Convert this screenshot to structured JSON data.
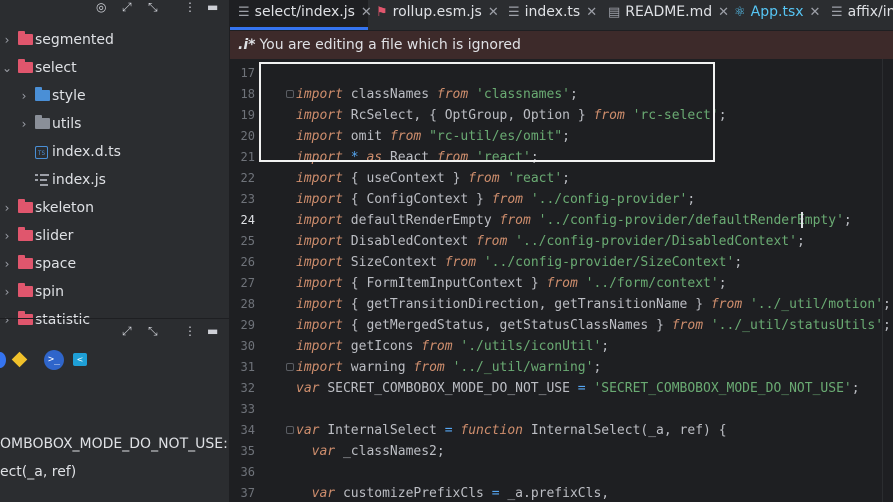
{
  "project_panel": {
    "tree": [
      {
        "label": "segmented",
        "expanded": false,
        "kind": "folder"
      },
      {
        "label": "select",
        "expanded": true,
        "kind": "folder"
      },
      {
        "label": "style",
        "expanded": false,
        "kind": "folder-blue"
      },
      {
        "label": "utils",
        "expanded": false,
        "kind": "folder-gray"
      },
      {
        "label": "index.d.ts",
        "kind": "ts-file"
      },
      {
        "label": "index.js",
        "kind": "js-file"
      },
      {
        "label": "skeleton",
        "expanded": false,
        "kind": "folder"
      },
      {
        "label": "slider",
        "expanded": false,
        "kind": "folder"
      },
      {
        "label": "space",
        "expanded": false,
        "kind": "folder"
      },
      {
        "label": "spin",
        "expanded": false,
        "kind": "folder"
      },
      {
        "label": "statistic",
        "expanded": false,
        "kind": "folder"
      }
    ]
  },
  "lower_panel": {
    "lines": [
      "OMBOBOX_MODE_DO_NOT_USE: st",
      "ect(_a, ref)"
    ]
  },
  "tabs": [
    {
      "label": "select/index.js",
      "active": true,
      "icon": "lines-icon"
    },
    {
      "label": "rollup.esm.js",
      "active": false,
      "icon": "rollup-icon"
    },
    {
      "label": "index.ts",
      "active": false,
      "icon": "lines-icon"
    },
    {
      "label": "README.md",
      "active": false,
      "icon": "book-icon"
    },
    {
      "label": "App.tsx",
      "active": false,
      "icon": "react-icon"
    },
    {
      "label": "affix/in",
      "active": false,
      "icon": "lines-icon"
    }
  ],
  "banner": {
    "icon_text": ".i*",
    "message": "You are editing a file which is ignored"
  },
  "editor": {
    "current_line": 24,
    "lines": [
      {
        "n": 17,
        "code": ""
      },
      {
        "n": 18,
        "code": "import classNames from 'classnames';"
      },
      {
        "n": 19,
        "code": "import RcSelect, { OptGroup, Option } from 'rc-select';"
      },
      {
        "n": 20,
        "code": "import omit from \"rc-util/es/omit\";"
      },
      {
        "n": 21,
        "code": "import * as React from 'react';"
      },
      {
        "n": 22,
        "code": "import { useContext } from 'react';"
      },
      {
        "n": 23,
        "code": "import { ConfigContext } from '../config-provider';"
      },
      {
        "n": 24,
        "code": "import defaultRenderEmpty from '../config-provider/defaultRenderEmpty';"
      },
      {
        "n": 25,
        "code": "import DisabledContext from '../config-provider/DisabledContext';"
      },
      {
        "n": 26,
        "code": "import SizeContext from '../config-provider/SizeContext';"
      },
      {
        "n": 27,
        "code": "import { FormItemInputContext } from '../form/context';"
      },
      {
        "n": 28,
        "code": "import { getTransitionDirection, getTransitionName } from '../_util/motion';"
      },
      {
        "n": 29,
        "code": "import { getMergedStatus, getStatusClassNames } from '../_util/statusUtils';"
      },
      {
        "n": 30,
        "code": "import getIcons from './utils/iconUtil';"
      },
      {
        "n": 31,
        "code": "import warning from '../_util/warning';"
      },
      {
        "n": 32,
        "code": "var SECRET_COMBOBOX_MODE_DO_NOT_USE = 'SECRET_COMBOBOX_MODE_DO_NOT_USE';"
      },
      {
        "n": 33,
        "code": ""
      },
      {
        "n": 34,
        "code": "var InternalSelect = function InternalSelect(_a, ref) {"
      },
      {
        "n": 35,
        "code": "  var _classNames2;"
      },
      {
        "n": 36,
        "code": ""
      },
      {
        "n": 37,
        "code": "  var customizePrefixCls = _a.prefixCls,"
      }
    ]
  },
  "colors": {
    "keyword": "#cf8e6d",
    "string": "#6aab73",
    "operator": "#56a8f5",
    "accent": "#3574f0",
    "banner": "#3d2a2a",
    "folder": "#e0566d"
  }
}
